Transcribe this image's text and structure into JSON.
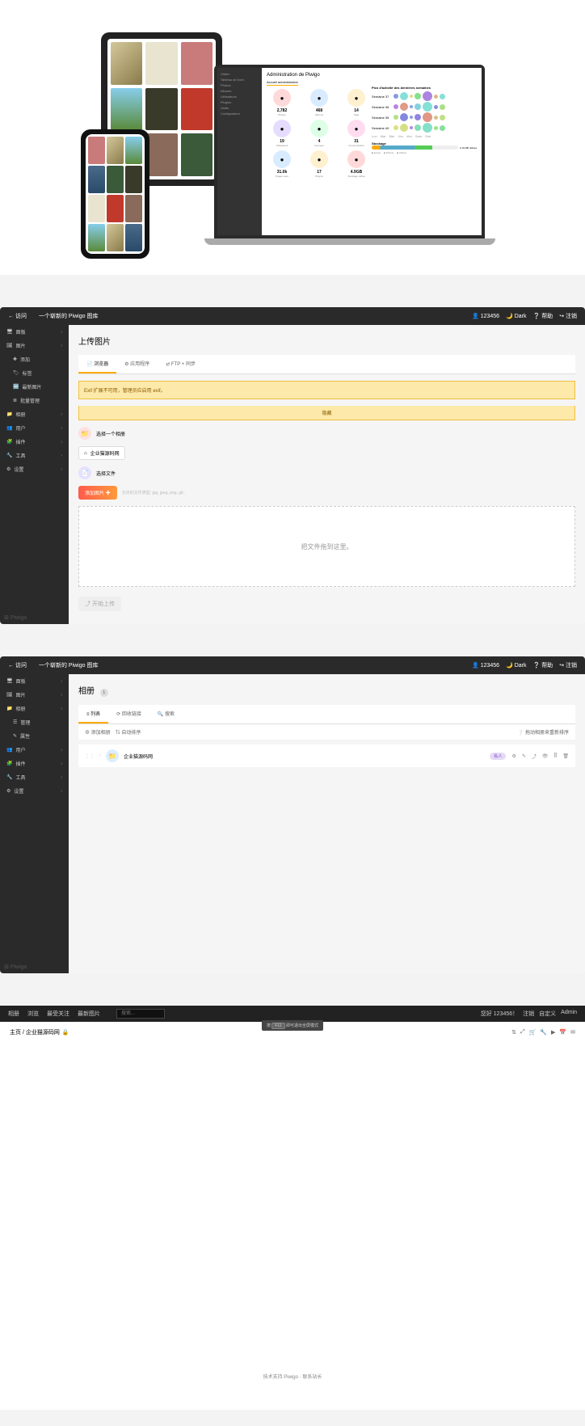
{
  "hero": {
    "laptop_side": [
      "Visiter",
      "Tableau de bord",
      "Photos",
      "Albums",
      "Utilisateurs",
      "Plugins",
      "Outils",
      "Configuration"
    ],
    "laptop_title": "Administration de Piwigo",
    "laptop_tab": "Accueil administration",
    "chart_title": "Pics d'activité des dernières semaines",
    "stats_r1": [
      {
        "num": "2,782",
        "label": "Photos",
        "color": "#ffd9d9"
      },
      {
        "num": "468",
        "label": "Albums",
        "color": "#d9ecff"
      },
      {
        "num": "14",
        "label": "Tags",
        "color": "#fff0d0"
      }
    ],
    "stats_r2": [
      {
        "num": "19",
        "label": "Utilisateurs",
        "color": "#e6dcff"
      },
      {
        "num": "4",
        "label": "Groupes",
        "color": "#dcffe6"
      },
      {
        "num": "31",
        "label": "Commentaires",
        "color": "#ffdcf0"
      }
    ],
    "stats_r3": [
      {
        "num": "31.0k",
        "label": "Pages vues",
        "color": "#d9ecff"
      },
      {
        "num": "17",
        "label": "Plugins",
        "color": "#fff0d0"
      },
      {
        "num": "4.9GB",
        "label": "Stockage utilisé",
        "color": "#ffd9d9"
      }
    ],
    "weeks": [
      "Semaine 37",
      "Semaine 36",
      "Semaine 35",
      "Semaine 40"
    ],
    "days": [
      "Lun",
      "Mar",
      "Mer",
      "Jeu",
      "Ven",
      "Sam",
      "Dim"
    ],
    "storage": "Stockage",
    "storage_val": "3.19 MB utilisés",
    "legend": [
      "Autres",
      "Photos",
      "Vidéos"
    ]
  },
  "app_title": "一个崭新的 Piwigo 图库",
  "visit": "← 访问",
  "user": "123456",
  "dark": "Dark",
  "help": "帮助",
  "logout": "注销",
  "brand": "Piwigo",
  "upload": {
    "title": "上传图片",
    "tabs": [
      "浏览器",
      "应用程序",
      "FTP + 同步"
    ],
    "tab_icons": [
      "📄",
      "⚙",
      "⇄"
    ],
    "warn": "Exif 扩展不可用，管理员应启用 exif。",
    "hide": "隐藏",
    "select_album_label": "选择一个相册",
    "album_name": "企业猫源码网",
    "select_file_label": "选择文件",
    "add_btn": "添加图片",
    "file_hint": "允许的文件类型: jpg, jpeg, png, gif。",
    "dropzone": "把文件拖到这里。",
    "start": "开始上传"
  },
  "side1": {
    "items": [
      "面板",
      "图片",
      "相册",
      "用户",
      "插件",
      "工具",
      "设置"
    ],
    "sub": [
      "添加",
      "标签",
      "最新图片",
      "批量管理"
    ],
    "icons": [
      "🖥",
      "🖼",
      "📁",
      "👥",
      "🧩",
      "🔧",
      "⚙"
    ],
    "sub_icons": [
      "✚",
      "🏷",
      "🆕",
      "≣"
    ]
  },
  "albums": {
    "title": "相册",
    "count": "1",
    "tabs": [
      "列表",
      "回收链接",
      "搜索"
    ],
    "tab_icons": [
      "≡",
      "⟳",
      "🔍"
    ],
    "tool_add": "添加相册",
    "tool_sort": "自动排序",
    "drag_hint": "拖动相册来重新排序",
    "name": "企业猫源码网",
    "badge": "私人",
    "row_icons": [
      "⚙",
      "✎",
      "⤴",
      "👁",
      "⫿⫿",
      "🗑"
    ]
  },
  "side2": {
    "items": [
      "面板",
      "图片",
      "相册",
      "用户",
      "插件",
      "工具",
      "设置"
    ],
    "sub": [
      "管理",
      "属性"
    ],
    "icons": [
      "🖥",
      "🖼",
      "📁",
      "👥",
      "🧩",
      "🔧",
      "⚙"
    ],
    "sub_icons": [
      "☰",
      "✎"
    ]
  },
  "fe": {
    "nav": [
      "相册",
      "浏览",
      "最受关注",
      "最新图片"
    ],
    "search_ph": "搜索...",
    "hello": "您好 123456！",
    "reg": "注销",
    "custom": "自定义",
    "admin": "Admin",
    "tip_prefix": "按",
    "tip_key": "F11",
    "tip_suffix": "即可退出全屏模式",
    "home": "主页",
    "album": "企业猫源码网",
    "lock": "🔒",
    "icons": [
      "⇅",
      "⤢",
      "🛒",
      "🔧",
      "▶",
      "📅",
      "✉"
    ],
    "footer_a": "技术支持 Piwigo",
    "footer_b": "联系站长"
  }
}
